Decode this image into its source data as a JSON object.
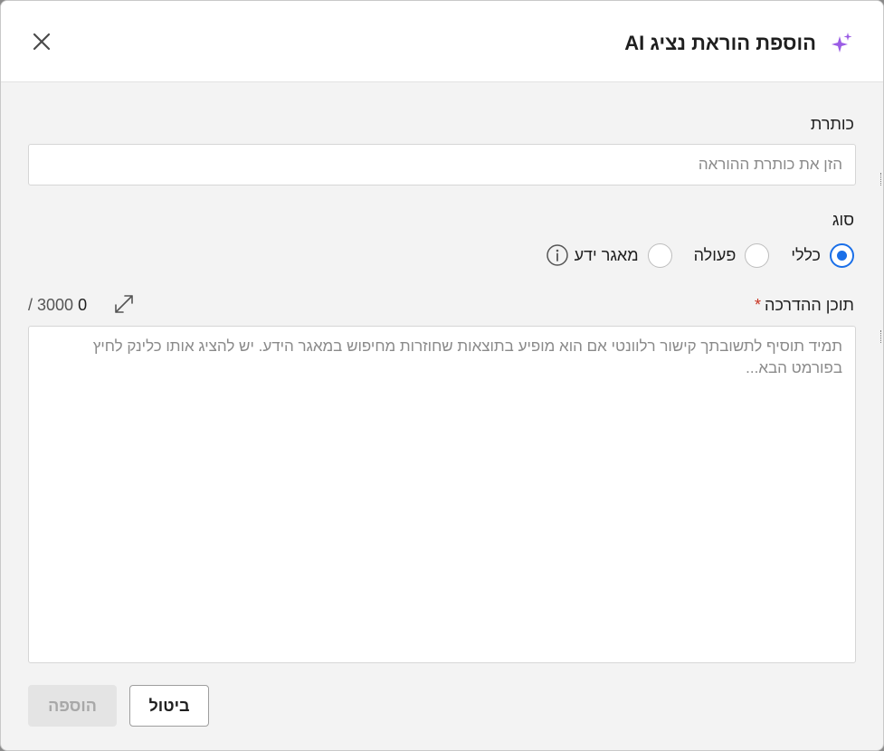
{
  "dialog": {
    "title": "הוספת הוראת נציג AI",
    "close_icon": "close-icon",
    "title_icon": "sparkle-icon",
    "accent_color": "#9b5de5"
  },
  "fields": {
    "title_label": "כותרת",
    "title_placeholder": "הזן את כותרת ההוראה",
    "type_label": "סוג",
    "type_options": [
      {
        "label": "כללי",
        "selected": true
      },
      {
        "label": "פעולה",
        "selected": false
      },
      {
        "label": "מאגר ידע",
        "selected": false
      }
    ],
    "content_label": "תוכן ההדרכה",
    "content_required_mark": "*",
    "content_placeholder": "תמיד תוסיף לתשובתך קישור רלוונטי אם הוא מופיע בתוצאות שחוזרות מחיפוש במאגר הידע. יש להציג אותו כלינק לחיץ בפורמט הבא...",
    "char_count": "0",
    "char_max": "/ 3000"
  },
  "buttons": {
    "cancel_label": "ביטול",
    "add_label": "הוספה"
  },
  "colors": {
    "radio_selected": "#1a6fe8",
    "required": "#c8321f"
  }
}
